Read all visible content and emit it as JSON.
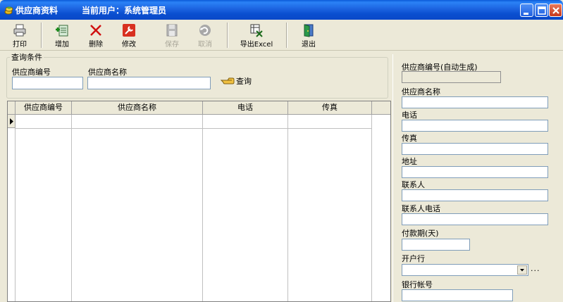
{
  "window": {
    "title": "供应商资料",
    "user": "当前用户：系统管理员",
    "icons": {
      "app": "coins-icon",
      "minimize": "minimize-icon",
      "maximize": "maximize-icon",
      "close": "close-icon"
    }
  },
  "toolbar": {
    "print": "打印",
    "add": "增加",
    "delete": "删除",
    "edit": "修改",
    "save": "保存",
    "cancel": "取消",
    "export": "导出Excel",
    "exit": "退出"
  },
  "query": {
    "legend": "查询条件",
    "code_label": "供应商编号",
    "name_label": "供应商名称",
    "code_value": "",
    "name_value": "",
    "search_label": "查询"
  },
  "grid": {
    "columns": [
      "供应商编号",
      "供应商名称",
      "电话",
      "传真"
    ]
  },
  "detail": {
    "code_label": "供应商编号(自动生成)",
    "name_label": "供应商名称",
    "phone_label": "电话",
    "fax_label": "传真",
    "address_label": "地址",
    "contact_label": "联系人",
    "contact_phone_label": "联系人电话",
    "payment_label": "付款期(天)",
    "bank_label": "开户行",
    "account_label": "银行帐号",
    "ellipsis": "..."
  },
  "colors": {
    "titlebar": "#0a4fd0",
    "window_bg": "#ece9d8",
    "input_border": "#7f9db9"
  }
}
